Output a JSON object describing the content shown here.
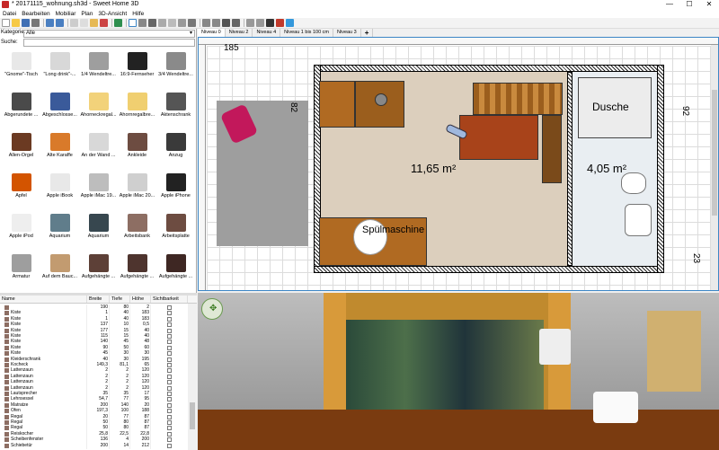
{
  "window": {
    "title": "* 20171115_wohnung.sh3d - Sweet Home 3D",
    "minimize": "—",
    "maximize": "☐",
    "close": "✕"
  },
  "menu": [
    "Datei",
    "Bearbeiten",
    "Mobiliar",
    "Plan",
    "3D-Ansicht",
    "Hilfe"
  ],
  "catalog": {
    "category_label": "Kategorie:",
    "category_value": "Alle",
    "search_label": "Suche:",
    "search_value": "",
    "items": [
      {
        "label": "\"Gnome\"-Tisch",
        "color": "#e8e8e8"
      },
      {
        "label": "\"Long drink\"-...",
        "color": "#d8d8d8"
      },
      {
        "label": "1/4 Wendeltre...",
        "color": "#9e9e9e"
      },
      {
        "label": "16:9-Fernseher",
        "color": "#222222"
      },
      {
        "label": "3/4 Wendeltre...",
        "color": "#8a8a8a"
      },
      {
        "label": "Abgerundete ...",
        "color": "#4a4a4a"
      },
      {
        "label": "Abgeschlosse...",
        "color": "#3a5a9a"
      },
      {
        "label": "Ahorneckregal...",
        "color": "#f2d27a"
      },
      {
        "label": "Ahornregalbre...",
        "color": "#f0cf70"
      },
      {
        "label": "Aktenschrank",
        "color": "#555555"
      },
      {
        "label": "Allen-Orgel",
        "color": "#6b3a22"
      },
      {
        "label": "Alte Karaffe",
        "color": "#d97a2a"
      },
      {
        "label": "An der Wand ...",
        "color": "#d8d8d8"
      },
      {
        "label": "Ankleide",
        "color": "#6d4c41"
      },
      {
        "label": "Anzug",
        "color": "#3a3a3a"
      },
      {
        "label": "Apfel",
        "color": "#d35400"
      },
      {
        "label": "Apple iBook",
        "color": "#e8e8e8"
      },
      {
        "label": "Apple iMac 19...",
        "color": "#bdbdbd"
      },
      {
        "label": "Apple iMac 20...",
        "color": "#cfcfcf"
      },
      {
        "label": "Apple iPhone",
        "color": "#222222"
      },
      {
        "label": "Apple iPod",
        "color": "#eeeeee"
      },
      {
        "label": "Aquarium",
        "color": "#607d8b"
      },
      {
        "label": "Aquarium",
        "color": "#37474f"
      },
      {
        "label": "Arbeitsbank",
        "color": "#8d6e63"
      },
      {
        "label": "Arbeitsplatte",
        "color": "#6d4c41"
      },
      {
        "label": "Armatur",
        "color": "#9e9e9e"
      },
      {
        "label": "Auf dem Bauc...",
        "color": "#c29b70"
      },
      {
        "label": "Aufgehängte ...",
        "color": "#5d4037"
      },
      {
        "label": "Aufgehängte ...",
        "color": "#4e342e"
      },
      {
        "label": "Aufgehängte ...",
        "color": "#3e2723"
      },
      {
        "label": "",
        "color": "#444444"
      },
      {
        "label": "",
        "color": "#c0b090"
      },
      {
        "label": "",
        "color": "#6d4c41"
      },
      {
        "label": "",
        "color": "#aaaaaa"
      },
      {
        "label": "",
        "color": "#c62828"
      }
    ]
  },
  "furniture_table": {
    "headers": [
      "Name",
      "Breite",
      "Tiefe",
      "Höhe",
      "Sichtbarkeit"
    ],
    "rows": [
      {
        "name": "",
        "w": "190",
        "d": "80",
        "h": "2"
      },
      {
        "name": "Kiste",
        "w": "1",
        "d": "40",
        "h": "183"
      },
      {
        "name": "Kiste",
        "w": "1",
        "d": "40",
        "h": "183"
      },
      {
        "name": "Kiste",
        "w": "137",
        "d": "10",
        "h": "0,5"
      },
      {
        "name": "Kiste",
        "w": "177",
        "d": "15",
        "h": "40"
      },
      {
        "name": "Kiste",
        "w": "115",
        "d": "15",
        "h": "40"
      },
      {
        "name": "Kiste",
        "w": "140",
        "d": "45",
        "h": "48"
      },
      {
        "name": "Kiste",
        "w": "90",
        "d": "50",
        "h": "60"
      },
      {
        "name": "Kiste",
        "w": "45",
        "d": "30",
        "h": "30"
      },
      {
        "name": "Kleiderschrank",
        "w": "40",
        "d": "30",
        "h": "195"
      },
      {
        "name": "Kocheck",
        "w": "149,3",
        "d": "81,1",
        "h": "65"
      },
      {
        "name": "Lattenzaun",
        "w": "2",
        "d": "2",
        "h": "120"
      },
      {
        "name": "Lattenzaun",
        "w": "2",
        "d": "2",
        "h": "120"
      },
      {
        "name": "Lattenzaun",
        "w": "2",
        "d": "2",
        "h": "120"
      },
      {
        "name": "Lattenzaun",
        "w": "2",
        "d": "2",
        "h": "120"
      },
      {
        "name": "Lautsprecher",
        "w": "35",
        "d": "35",
        "h": "17"
      },
      {
        "name": "Lehnsessel",
        "w": "54,7",
        "d": "77",
        "h": "95"
      },
      {
        "name": "Matratze",
        "w": "200",
        "d": "140",
        "h": "20"
      },
      {
        "name": "Ofen",
        "w": "197,3",
        "d": "100",
        "h": "188"
      },
      {
        "name": "Regal",
        "w": "20",
        "d": "77",
        "h": "87"
      },
      {
        "name": "Regal",
        "w": "50",
        "d": "80",
        "h": "87"
      },
      {
        "name": "Regal",
        "w": "50",
        "d": "80",
        "h": "87"
      },
      {
        "name": "Reiskocher",
        "w": "25,8",
        "d": "22,5",
        "h": "22,8"
      },
      {
        "name": "Scheibenfenster",
        "w": "136",
        "d": "4",
        "h": "200"
      },
      {
        "name": "Schiebetür",
        "w": "200",
        "d": "14",
        "h": "212"
      }
    ]
  },
  "plan": {
    "tabs": [
      "Niveau 0",
      "Niveau 2",
      "Niveau 4",
      "Niveau 1 bis 100 cm",
      "Niveau 3"
    ],
    "add_tab": "+",
    "dim_top": "185",
    "dim_left": "82",
    "dim_right": "92",
    "dim_bottom_right": "23",
    "room_main_area": "11,65 m²",
    "room_bath_area": "4,05 m²",
    "label_shower": "Dusche",
    "label_dishwasher": "Spülmaschine"
  },
  "view3d": {
    "nav_control": "navigation-control"
  }
}
